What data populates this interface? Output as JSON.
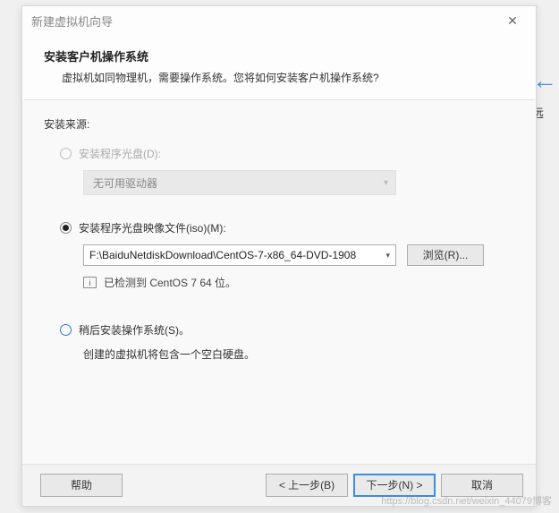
{
  "backdrop": {
    "remote_hint": "远"
  },
  "titlebar": {
    "title": "新建虚拟机向导"
  },
  "header": {
    "heading": "安装客户机操作系统",
    "subheading": "虚拟机如同物理机，需要操作系统。您将如何安装客户机操作系统?"
  },
  "source": {
    "label": "安装来源:",
    "disc": {
      "label": "安装程序光盘(D):",
      "dropdown": "无可用驱动器"
    },
    "iso": {
      "label": "安装程序光盘映像文件(iso)(M):",
      "path": "F:\\BaiduNetdiskDownload\\CentOS-7-x86_64-DVD-1908",
      "browse": "浏览(R)...",
      "detected": "已检测到 CentOS 7 64 位。"
    },
    "later": {
      "label": "稍后安装操作系统(S)。",
      "desc": "创建的虚拟机将包含一个空白硬盘。"
    }
  },
  "footer": {
    "help": "帮助",
    "back": "< 上一步(B)",
    "next": "下一步(N) >",
    "cancel": "取消"
  },
  "watermark": "https://blog.csdn.net/weixin_44079博客"
}
